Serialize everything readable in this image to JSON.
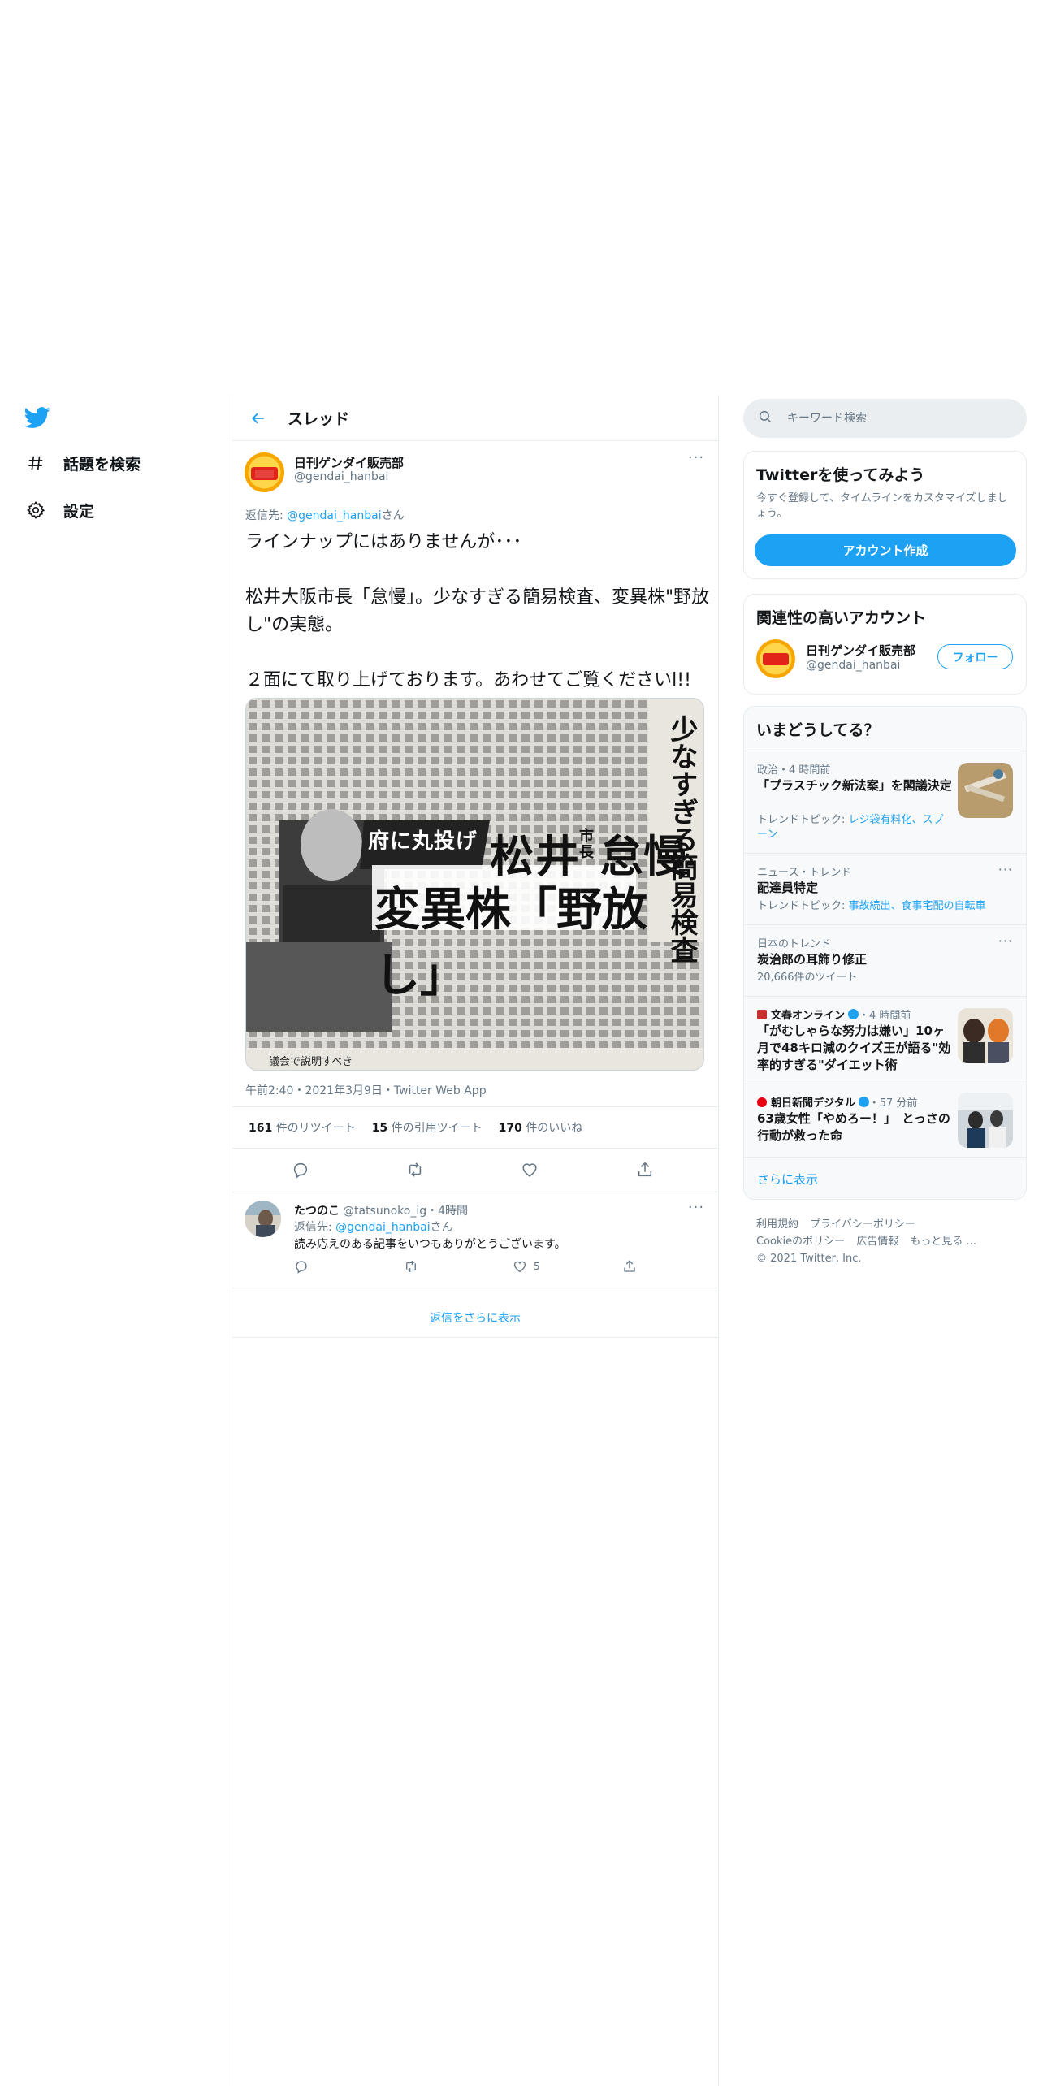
{
  "nav": {
    "items": [
      {
        "label": "話題を検索",
        "icon": "hashtag-icon"
      },
      {
        "label": "設定",
        "icon": "gear-icon"
      }
    ]
  },
  "header": {
    "title": "スレッド"
  },
  "tweet": {
    "name": "日刊ゲンダイ販売部",
    "handle": "@gendai_hanbai",
    "reply_prefix": "返信先: ",
    "reply_handle": "@gendai_hanbai",
    "reply_suffix": "さん",
    "text": "ラインナップにはありませんが･･･\n\n松井大阪市長「怠慢」。少なすぎる簡易検査、変異株\"野放し\"の実態。\n\n２面にて取り上げております。あわせてご覧くださいl!!",
    "image": {
      "banner_left": "府に丸投げ",
      "name1": "松井",
      "small_kana": "市長",
      "verb": "怠慢",
      "line2": "変異株「野放し」",
      "side_head": "少なすぎる簡易検査",
      "caption": "議会で説明すべき"
    },
    "timestamp": "午前2:40・2021年3月9日・Twitter Web App",
    "stats": {
      "retweets_count": "161",
      "retweets_label": "件のリツイート",
      "quotes_count": "15",
      "quotes_label": "件の引用ツイート",
      "likes_count": "170",
      "likes_label": "件のいいね"
    }
  },
  "reply": {
    "name": "たつのこ",
    "handle": "@tatsunoko_ig",
    "time": "・4時間",
    "reply_prefix": "返信先: ",
    "reply_handle": "@gendai_hanbai",
    "reply_suffix": "さん",
    "text": "読み応えのある記事をいつもありがとうございます。",
    "likes": "5"
  },
  "more_replies": "返信をさらに表示",
  "search": {
    "placeholder": "キーワード検索"
  },
  "signup": {
    "title": "Twitterを使ってみよう",
    "subtitle": "今すぐ登録して、タイムラインをカスタマイズしましょう。",
    "button": "アカウント作成"
  },
  "related": {
    "title": "関連性の高いアカウント",
    "name": "日刊ゲンダイ販売部",
    "handle": "@gendai_hanbai",
    "follow": "フォロー"
  },
  "trends": {
    "title": "いまどうしてる？",
    "items": [
      {
        "context": "政治・4 時間前",
        "title": "「プラスチック新法案」を閣議決定",
        "sub_prefix": "トレンドトピック: ",
        "sub_link": "レジ袋有料化、スプーン"
      },
      {
        "context": "ニュース・トレンド",
        "title": "配達員特定",
        "sub_prefix": "トレンドトピック: ",
        "sub_link": "事故続出、食事宅配の自転車"
      },
      {
        "context": "日本のトレンド",
        "title": "炭治郎の耳飾り修正",
        "sub": "20,666件のツイート"
      },
      {
        "source": "文春オンライン",
        "time": "・4 時間前",
        "title": "「がむしゃらな努力は嫌い」10ヶ月で48キロ減のクイズ王が語る\"効率的すぎる\"ダイエット術"
      },
      {
        "source": "朝日新聞デジタル",
        "time": "・57 分前",
        "title": "63歳女性「やめろー！」　とっさの行動が救った命"
      }
    ],
    "show_more": "さらに表示"
  },
  "footer": {
    "links1": [
      "利用規約",
      "プライバシーポリシー"
    ],
    "links2": [
      "Cookieのポリシー",
      "広告情報",
      "もっと見る ..."
    ],
    "copyright": "© 2021 Twitter, Inc."
  },
  "colors": {
    "accent": "#1da1f2",
    "text": "#14171a",
    "muted": "#657786",
    "border": "#e6ecf0"
  }
}
